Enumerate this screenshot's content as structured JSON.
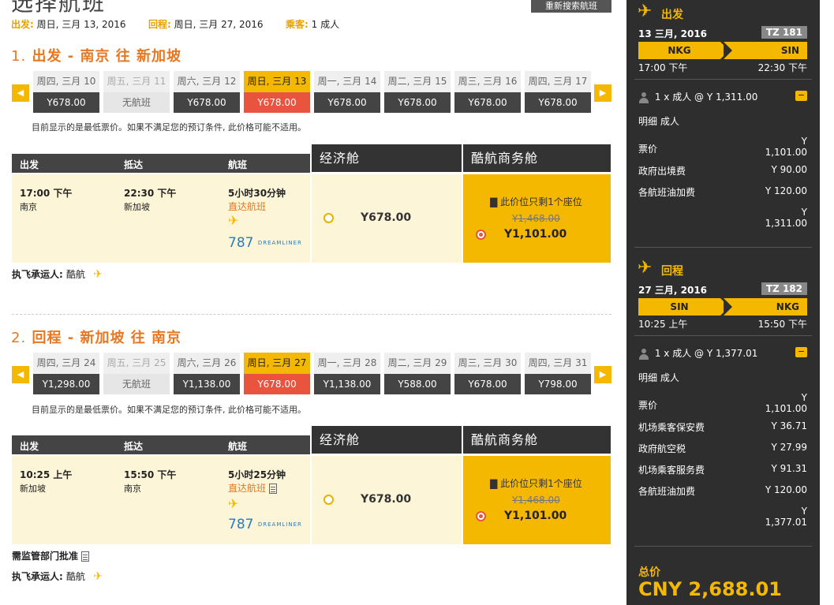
{
  "header": {
    "title": "选择航班",
    "research_button": "重新搜索航班",
    "depart_label": "出发:",
    "depart_value": "周日, 三月 13, 2016",
    "return_label": "回程:",
    "return_value": "周日, 三月 27, 2016",
    "pax_label": "乘客:",
    "pax_value": "1 成人"
  },
  "outbound": {
    "num": "1.",
    "title": "出发 - 南京 往 新加坡",
    "dates": [
      {
        "label": "周四, 三月 10",
        "price": "Y678.00",
        "state": "normal"
      },
      {
        "label": "周五, 三月 11",
        "price": "无航班",
        "state": "na"
      },
      {
        "label": "周六, 三月 12",
        "price": "Y678.00",
        "state": "normal"
      },
      {
        "label": "周日, 三月 13",
        "price": "Y678.00",
        "state": "sel"
      },
      {
        "label": "周一, 三月 14",
        "price": "Y678.00",
        "state": "normal"
      },
      {
        "label": "周二, 三月 15",
        "price": "Y678.00",
        "state": "normal"
      },
      {
        "label": "周三, 三月 16",
        "price": "Y678.00",
        "state": "normal"
      },
      {
        "label": "周四, 三月 17",
        "price": "Y678.00",
        "state": "normal"
      }
    ],
    "note": "目前显示的是最低票价。如果不满足您的预订条件, 此价格可能不适用。",
    "col_dep": "出发",
    "col_arr": "抵达",
    "col_flight": "航班",
    "eco_head": "经济舱",
    "biz_head": "酷航商务舱",
    "dep_time": "17:00 下午",
    "dep_city": "南京",
    "arr_time": "22:30 下午",
    "arr_city": "新加坡",
    "duration": "5小时30分钟",
    "direct": "直达航班",
    "aircraft_num": "787",
    "aircraft_name": "DREAMLINER",
    "eco_price": "Y678.00",
    "biz_seat": "此价位只剩1个座位",
    "biz_old": "Y1,468.00",
    "biz_price": "Y1,101.00",
    "operated_label": "执飞承运人:",
    "operated_value": "酷航"
  },
  "inbound": {
    "num": "2.",
    "title": "回程 - 新加坡 往 南京",
    "dates": [
      {
        "label": "周四, 三月 24",
        "price": "Y1,298.00",
        "state": "normal"
      },
      {
        "label": "周五, 三月 25",
        "price": "无航班",
        "state": "na"
      },
      {
        "label": "周六, 三月 26",
        "price": "Y1,138.00",
        "state": "normal"
      },
      {
        "label": "周日, 三月 27",
        "price": "Y678.00",
        "state": "sel"
      },
      {
        "label": "周一, 三月 28",
        "price": "Y1,138.00",
        "state": "normal"
      },
      {
        "label": "周二, 三月 29",
        "price": "Y588.00",
        "state": "normal"
      },
      {
        "label": "周三, 三月 30",
        "price": "Y678.00",
        "state": "normal"
      },
      {
        "label": "周四, 三月 31",
        "price": "Y798.00",
        "state": "normal"
      }
    ],
    "note": "目前显示的是最低票价。如果不满足您的预订条件, 此价格可能不适用。",
    "col_dep": "出发",
    "col_arr": "抵达",
    "col_flight": "航班",
    "eco_head": "经济舱",
    "biz_head": "酷航商务舱",
    "dep_time": "10:25 上午",
    "dep_city": "新加坡",
    "arr_time": "15:50 下午",
    "arr_city": "南京",
    "duration": "5小时25分钟",
    "direct": "直达航班",
    "aircraft_num": "787",
    "aircraft_name": "DREAMLINER",
    "eco_price": "Y678.00",
    "biz_seat": "此价位只剩1个座位",
    "biz_old": "Y1,468.00",
    "biz_price": "Y1,101.00",
    "regulatory": "需监管部门批准",
    "operated_label": "执飞承运人:",
    "operated_value": "酷航"
  },
  "sidebar": {
    "out_head": "出发",
    "out_date": "13 三月, 2016",
    "out_flight": "TZ 181",
    "out_from": "NKG",
    "out_to": "SIN",
    "out_dep": "17:00 下午",
    "out_arr": "22:30 下午",
    "out_pax": "1 x 成人 @ Y 1,311.00",
    "out_detail": "明细 成人",
    "out_rows": [
      {
        "label": "票价",
        "value": "Y\n1,101.00"
      },
      {
        "label": "政府出境费",
        "value": "Y 90.00"
      },
      {
        "label": "各航班油加费",
        "value": "Y 120.00"
      },
      {
        "label": "",
        "value": "Y\n1,311.00"
      }
    ],
    "ret_head": "回程",
    "ret_date": "27 三月, 2016",
    "ret_flight": "TZ 182",
    "ret_from": "SIN",
    "ret_to": "NKG",
    "ret_dep": "10:25 上午",
    "ret_arr": "15:50 下午",
    "ret_pax": "1 x 成人 @ Y 1,377.01",
    "ret_detail": "明细 成人",
    "ret_rows": [
      {
        "label": "票价",
        "value": "Y\n1,101.00"
      },
      {
        "label": "机场乘客保安费",
        "value": "Y 36.71"
      },
      {
        "label": "政府航空税",
        "value": "Y 27.99"
      },
      {
        "label": "机场乘客服务费",
        "value": "Y 91.31"
      },
      {
        "label": "各航班油加费",
        "value": "Y 120.00"
      },
      {
        "label": "",
        "value": "Y\n1,377.01"
      }
    ],
    "total_label": "总价",
    "total_value": "CNY 2,688.01"
  }
}
